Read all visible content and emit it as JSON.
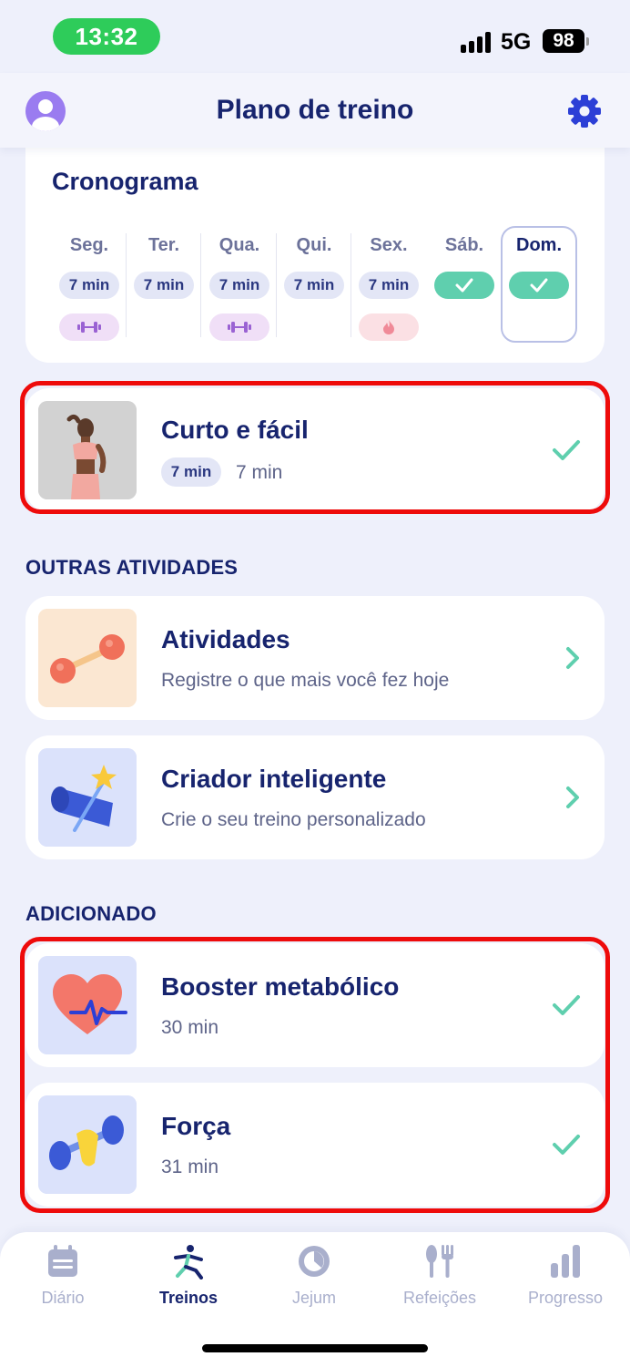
{
  "status_bar": {
    "time": "13:32",
    "network": "5G",
    "battery": "98"
  },
  "header": {
    "title": "Plano de treino",
    "avatar_icon": "user-avatar-icon",
    "settings_icon": "gear-icon"
  },
  "schedule": {
    "title": "Cronograma",
    "days": [
      {
        "label": "Seg.",
        "chip": "7 min",
        "extra": "strength"
      },
      {
        "label": "Ter.",
        "chip": "7 min",
        "extra": ""
      },
      {
        "label": "Qua.",
        "chip": "7 min",
        "extra": "strength"
      },
      {
        "label": "Qui.",
        "chip": "7 min",
        "extra": ""
      },
      {
        "label": "Sex.",
        "chip": "7 min",
        "extra": "fire"
      },
      {
        "label": "Sáb.",
        "chip": "check",
        "extra": ""
      },
      {
        "label": "Dom.",
        "chip": "check",
        "extra": ""
      }
    ]
  },
  "featured_workout": {
    "title": "Curto e fácil",
    "chip": "7 min",
    "duration": "7 min"
  },
  "other_activities": {
    "section_title": "OUTRAS ATIVIDADES",
    "items": [
      {
        "title": "Atividades",
        "subtitle": "Registre o que mais você fez hoje",
        "icon": "dumbbell-icon"
      },
      {
        "title": "Criador inteligente",
        "subtitle": "Crie o seu treino personalizado",
        "icon": "yoga-mat-icon"
      }
    ]
  },
  "added": {
    "section_title": "ADICIONADO",
    "items": [
      {
        "title": "Booster metabólico",
        "subtitle": "30 min",
        "icon": "heart-pulse-icon"
      },
      {
        "title": "Força",
        "subtitle": "31 min",
        "icon": "dumbbell-hand-icon"
      }
    ]
  },
  "bottom_nav": {
    "items": [
      {
        "label": "Diário",
        "icon": "calendar-icon",
        "active": false
      },
      {
        "label": "Treinos",
        "icon": "workout-icon",
        "active": true
      },
      {
        "label": "Jejum",
        "icon": "fasting-clock-icon",
        "active": false
      },
      {
        "label": "Refeições",
        "icon": "fork-knife-icon",
        "active": false
      },
      {
        "label": "Progresso",
        "icon": "bar-chart-icon",
        "active": false
      }
    ]
  },
  "colors": {
    "accent": "#17246e",
    "check": "#5fcfae",
    "highlight": "#ee0b0b",
    "background": "#eef0fb"
  }
}
